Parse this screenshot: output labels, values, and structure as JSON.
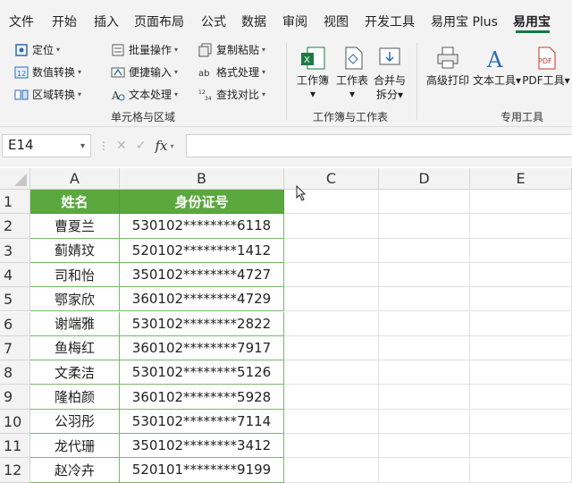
{
  "tabs": [
    "文件",
    "开始",
    "插入",
    "页面布局",
    "公式",
    "数据",
    "审阅",
    "视图",
    "开发工具",
    "易用宝 Plus",
    "易用宝"
  ],
  "active_tab": "易用宝",
  "ribbon": {
    "locate": "定位",
    "num_convert": "数值转换",
    "area_convert": "区域转换",
    "batch_ops": "批量操作",
    "quick_input": "便捷输入",
    "text_process": "文本处理",
    "copy_paste": "复制粘贴",
    "format_process": "格式处理",
    "find_compare": "查找对比",
    "group1_label": "单元格与区域",
    "workbook": "工作簿",
    "worksheet": "工作表",
    "merge_split_1": "合并与",
    "merge_split_2": "拆分",
    "group2_label": "工作簿与工作表",
    "adv_print": "高级打印",
    "text_tool": "文本工具",
    "pdf_tool": "PDF工具",
    "pdf_badge": "PDF",
    "group3_label": "专用工具",
    "excel_badge": "X"
  },
  "formula_bar": {
    "name_box": "E14",
    "fx": "fx",
    "cancel": "✕",
    "confirm": "✓",
    "dots": "⋮",
    "value": ""
  },
  "columns": [
    "A",
    "B",
    "C",
    "D",
    "E"
  ],
  "rows": [
    "1",
    "2",
    "3",
    "4",
    "5",
    "6",
    "7",
    "8",
    "9",
    "10",
    "11",
    "12"
  ],
  "table": {
    "headers": [
      "姓名",
      "身份证号"
    ],
    "data": [
      [
        "曹夏兰",
        "530102********6118"
      ],
      [
        "蓟婧玟",
        "520102********1412"
      ],
      [
        "司和怡",
        "350102********4727"
      ],
      [
        "鄂家欣",
        "360102********4729"
      ],
      [
        "谢端雅",
        "530102********2822"
      ],
      [
        "鱼梅红",
        "360102********7917"
      ],
      [
        "文柔洁",
        "530102********5126"
      ],
      [
        "隆柏颜",
        "360102********5928"
      ],
      [
        "公羽彤",
        "530102********7114"
      ],
      [
        "龙代珊",
        "350102********3412"
      ],
      [
        "赵冷卉",
        "520101********9199"
      ]
    ]
  },
  "colors": {
    "header_green": "#5ba83f",
    "accent": "#107c41"
  }
}
